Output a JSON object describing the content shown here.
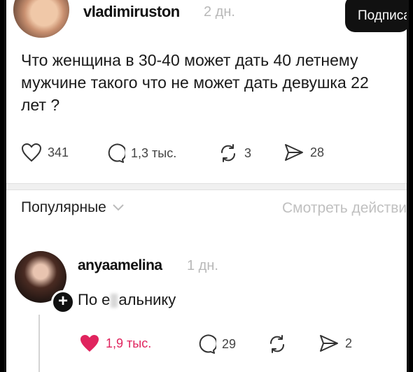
{
  "post": {
    "username": "vladimiruston",
    "time": "2 дн.",
    "subscribe_label": "Подписаться",
    "text_lines": [
      "Что женщина в 30-40 может дать 40 летнему",
      "мужчине такого что не может дать девушка 22",
      "лет ?"
    ],
    "likes": "341",
    "comments": "1,3 тыс.",
    "reposts": "3",
    "shares": "28"
  },
  "comments_header": {
    "sort_label": "Популярные",
    "view_activity_label": "Смотреть действия"
  },
  "comment": {
    "username": "anyaamelina",
    "time": "1 дн.",
    "text_before": "По е",
    "text_after": "альнику",
    "likes": "1,9 тыс.",
    "replies": "29",
    "reposts": "",
    "shares": "2",
    "like_color": "#e0245e"
  }
}
